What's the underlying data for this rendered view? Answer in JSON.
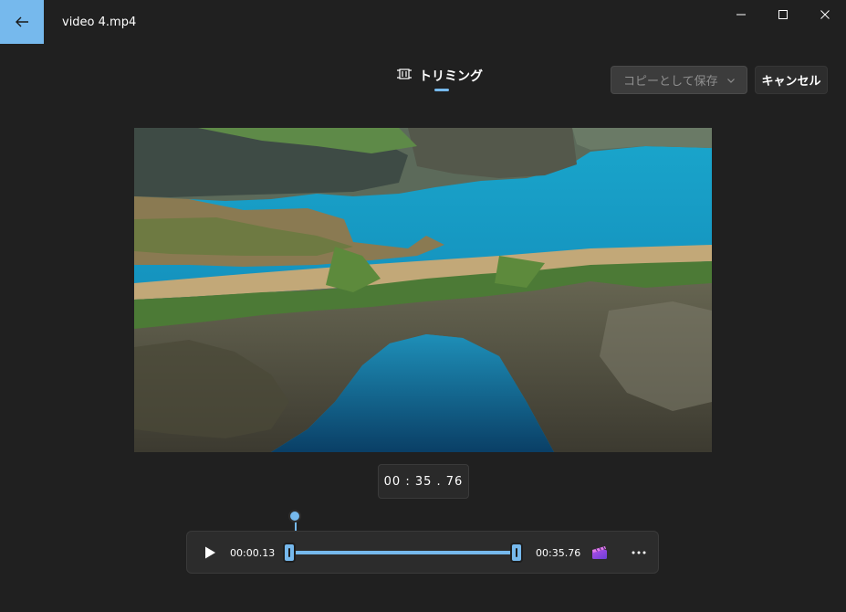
{
  "window": {
    "title": "video 4.mp4"
  },
  "tab": {
    "label": "トリミング",
    "icon": "trim-icon"
  },
  "toolbar": {
    "save_label": "コピーとして保存",
    "cancel_label": "キャンセル"
  },
  "player": {
    "current_time": "00 : 35 . 76",
    "trim_start": "00:00.13",
    "trim_end": "00:35.76"
  },
  "colors": {
    "accent": "#76b9ed",
    "background": "#202020",
    "panel": "#2c2c2c"
  }
}
